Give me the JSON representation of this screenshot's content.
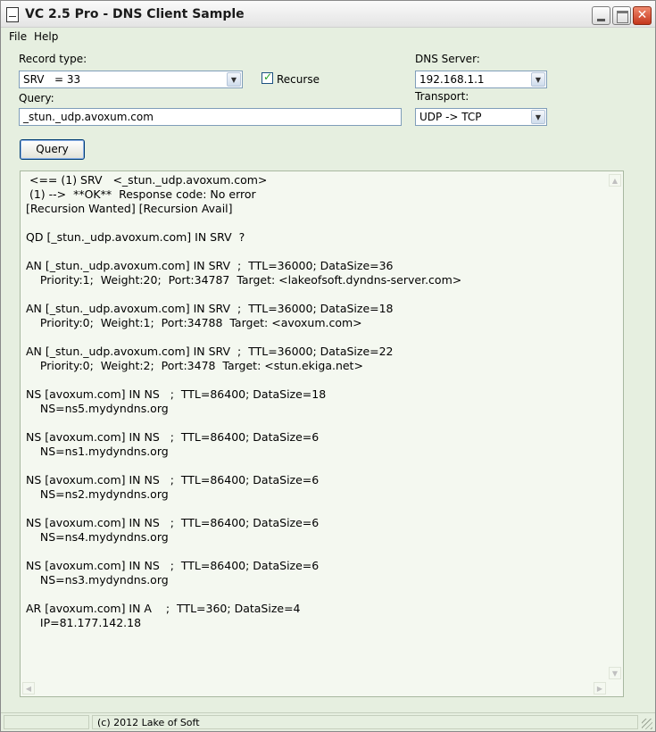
{
  "window": {
    "title": "VC 2.5 Pro - DNS Client Sample"
  },
  "menu": {
    "file": "File",
    "help": "Help"
  },
  "form": {
    "record_type_label": "Record type:",
    "record_type_value": "SRV   = 33",
    "recurse_label": "Recurse",
    "recurse_checked": true,
    "query_label": "Query:",
    "query_value": "_stun._udp.avoxum.com",
    "dns_server_label": "DNS Server:",
    "dns_server_value": "192.168.1.1",
    "transport_label": "Transport:",
    "transport_value": "UDP -> TCP",
    "query_button": "Query"
  },
  "output": {
    "lines": [
      " <== (1) SRV   <_stun._udp.avoxum.com>",
      " (1) -->  **OK**  Response code: No error",
      "[Recursion Wanted] [Recursion Avail]",
      "",
      "QD [_stun._udp.avoxum.com] IN SRV  ?",
      "",
      "AN [_stun._udp.avoxum.com] IN SRV  ;  TTL=36000; DataSize=36",
      "    Priority:1;  Weight:20;  Port:34787  Target: <lakeofsoft.dyndns-server.com>",
      "",
      "AN [_stun._udp.avoxum.com] IN SRV  ;  TTL=36000; DataSize=18",
      "    Priority:0;  Weight:1;  Port:34788  Target: <avoxum.com>",
      "",
      "AN [_stun._udp.avoxum.com] IN SRV  ;  TTL=36000; DataSize=22",
      "    Priority:0;  Weight:2;  Port:3478  Target: <stun.ekiga.net>",
      "",
      "NS [avoxum.com] IN NS   ;  TTL=86400; DataSize=18",
      "    NS=ns5.mydyndns.org",
      "",
      "NS [avoxum.com] IN NS   ;  TTL=86400; DataSize=6",
      "    NS=ns1.mydyndns.org",
      "",
      "NS [avoxum.com] IN NS   ;  TTL=86400; DataSize=6",
      "    NS=ns2.mydyndns.org",
      "",
      "NS [avoxum.com] IN NS   ;  TTL=86400; DataSize=6",
      "    NS=ns4.mydyndns.org",
      "",
      "NS [avoxum.com] IN NS   ;  TTL=86400; DataSize=6",
      "    NS=ns3.mydyndns.org",
      "",
      "AR [avoxum.com] IN A    ;  TTL=360; DataSize=4",
      "    IP=81.177.142.18"
    ]
  },
  "status": {
    "text": "(c) 2012 Lake of Soft"
  }
}
